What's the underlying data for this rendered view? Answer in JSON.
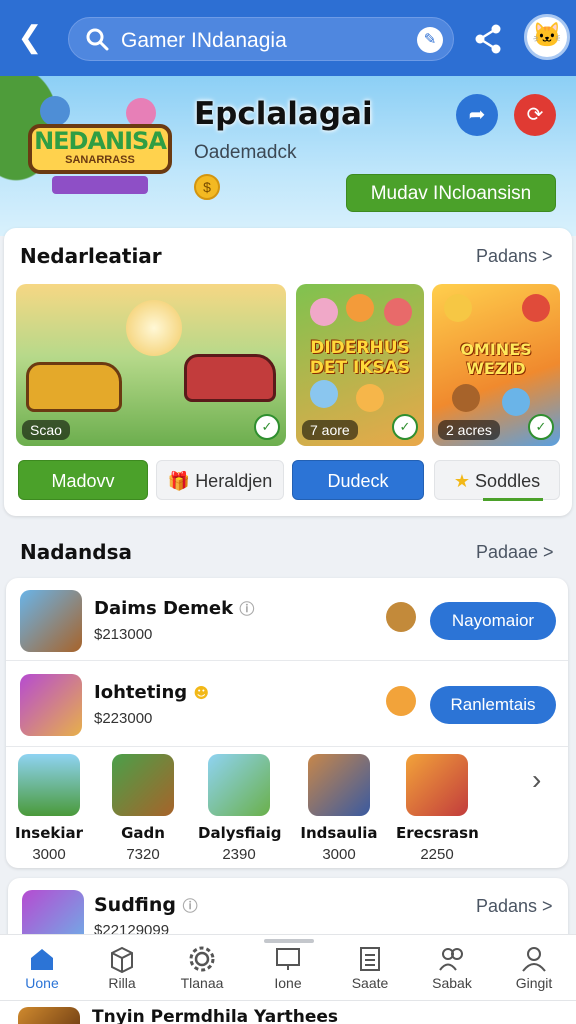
{
  "header": {
    "search_text": "Gamer INdanagia"
  },
  "hero": {
    "logo_name": "NEDANISA",
    "logo_sub": "SANARRASS",
    "title": "Epclalagai",
    "subtitle": "Oademadck",
    "button_label": "Mudav INcloansisn"
  },
  "featured": {
    "title": "Nedarleatiar",
    "link": "Padans >",
    "tiles": [
      {
        "label": "Scao"
      },
      {
        "art_text": "DIDERHUS DET IKSAS",
        "label": "7 aore"
      },
      {
        "art_text": "OMINES WEZID",
        "label": "2 acres"
      }
    ],
    "pills": [
      "Madovv",
      "Heraldjen",
      "Dudeck",
      "Soddles"
    ]
  },
  "list": {
    "title": "Nadandsa",
    "link": "Padaae >",
    "rows": [
      {
        "name": "Daims Demek",
        "price": "$213000",
        "button": "Nayomaior"
      },
      {
        "name": "Iohteting",
        "price": "$223000",
        "button": "Ranlemtais"
      }
    ],
    "strip": [
      {
        "name": "Insekiar",
        "value": "3000"
      },
      {
        "name": "Gadn",
        "value": "7320"
      },
      {
        "name": "Dalysfiaig",
        "value": "2390"
      },
      {
        "name": "Indsaulia",
        "value": "3000"
      },
      {
        "name": "Erecsrasn",
        "value": "2250"
      }
    ]
  },
  "next_section": {
    "title": "Sudfing",
    "price": "$22129099",
    "link": "Padans >"
  },
  "nav": {
    "items": [
      "Uone",
      "Rilla",
      "Tlanaa",
      "Ione",
      "Saate",
      "Sabak",
      "Gingit"
    ]
  },
  "peek": {
    "text": "Tnyin Permdhila Yarthees"
  },
  "colors": {
    "primary_blue": "#2c74d6",
    "primary_green": "#4ba12a",
    "alert_red": "#e03a33"
  }
}
